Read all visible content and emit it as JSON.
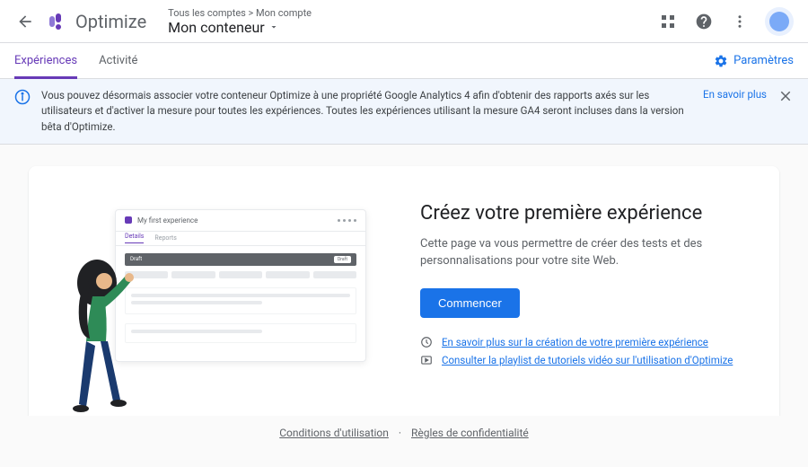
{
  "header": {
    "product_name": "Optimize",
    "breadcrumb": "Tous les comptes > Mon compte",
    "container_name": "Mon conteneur"
  },
  "subnav": {
    "tabs": [
      {
        "label": "Expériences",
        "active": true
      },
      {
        "label": "Activité",
        "active": false
      }
    ],
    "settings_label": "Paramètres"
  },
  "banner": {
    "text": "Vous pouvez désormais associer votre conteneur Optimize à une propriété Google Analytics 4 afin d'obtenir des rapports axés sur les utilisateurs et d'activer la mesure pour toutes les expériences. Toutes les expériences utilisant la mesure GA4 seront incluses dans la version bêta d'Optimize.",
    "link": "En savoir plus"
  },
  "hero": {
    "title": "Créez votre première expérience",
    "desc": "Cette page va vous permettre de créer des tests et des personnalisations pour votre site Web.",
    "cta": "Commencer",
    "links": [
      "En savoir plus sur la création de votre première expérience",
      "Consulter la playlist de tutoriels vidéo sur l'utilisation d'Optimize"
    ],
    "mock": {
      "title": "My first experience",
      "tab1": "Details",
      "tab2": "Reports",
      "draft_label": "Draft",
      "draft_badge": "Draft"
    }
  },
  "footer": {
    "terms": "Conditions d'utilisation",
    "privacy": "Règles de confidentialité"
  }
}
